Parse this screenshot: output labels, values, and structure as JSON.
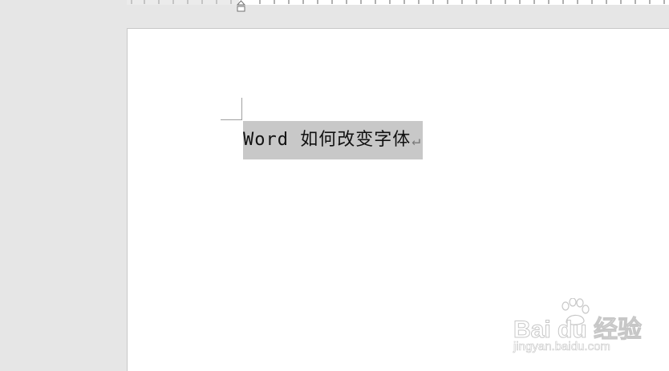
{
  "document": {
    "text": "Word 如何改变字体",
    "paragraph_mark": "↵",
    "selected": true
  },
  "watermark": {
    "logo_text": "Bai du 经验",
    "url_text": "jingyan.baidu.com"
  },
  "colors": {
    "workspace_bg": "#e6e6e6",
    "page_bg": "#ffffff",
    "selection_bg": "#c8c8c8",
    "text": "#111111"
  },
  "icons": {
    "indent_marker": "first-line-indent-icon",
    "paragraph_mark": "paragraph-mark-icon",
    "watermark_paw": "baidu-paw-icon"
  }
}
